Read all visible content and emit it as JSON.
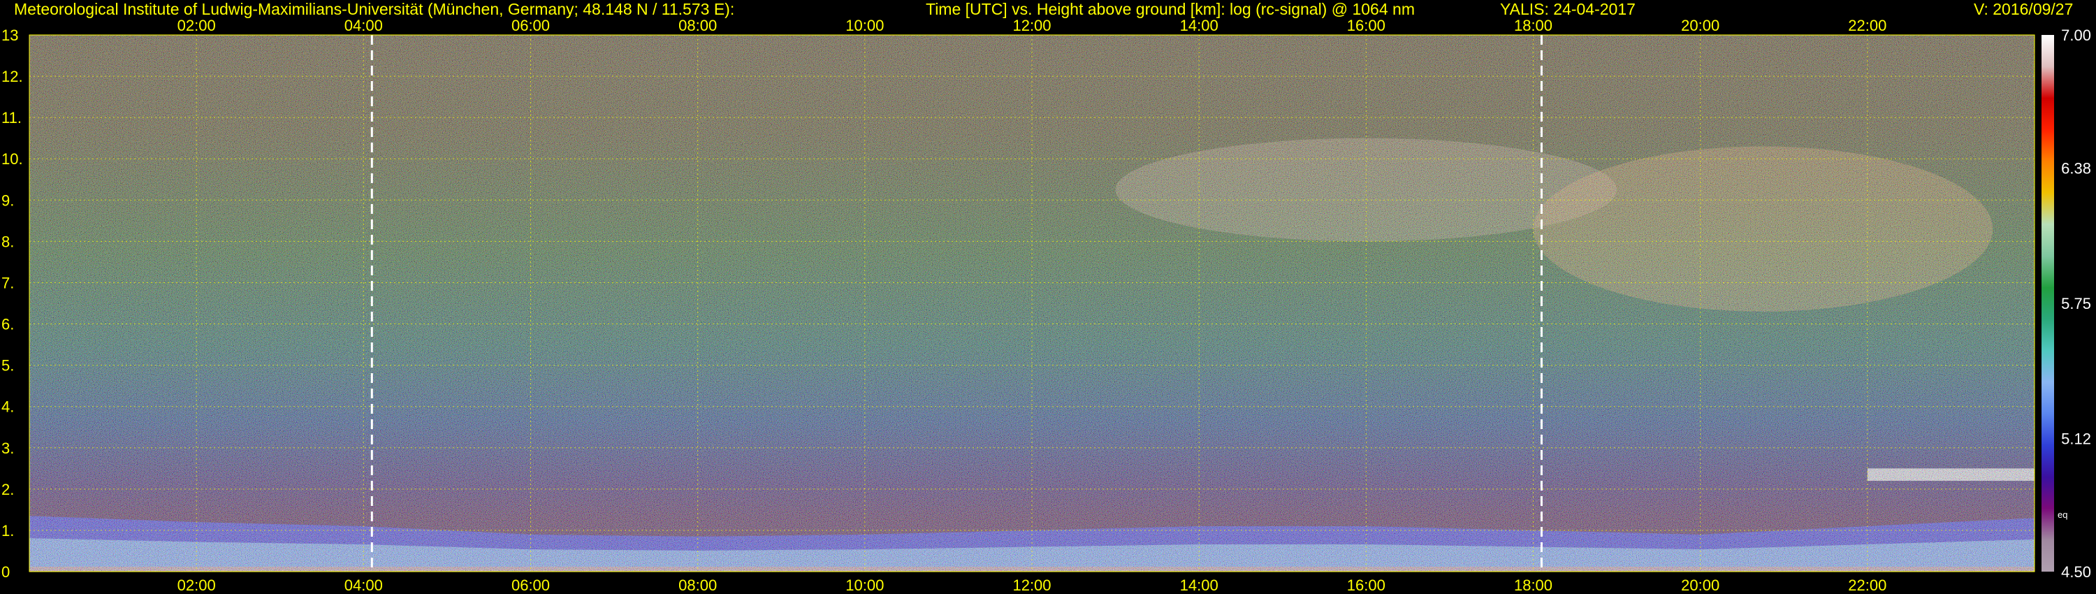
{
  "header": {
    "institute": "Meteorological Institute of Ludwig-Maximilians-Universität (München, Germany; 48.148 N / 11.573 E):",
    "description": "Time [UTC] vs. Height above ground [km]: log (rc-signal) @ 1064 nm",
    "instrument_date": "YALIS: 24-04-2017",
    "version": "V: 2016/09/27"
  },
  "chart_data": {
    "type": "heatmap",
    "xlabel": "Time [UTC]",
    "ylabel": "Height above ground [km]",
    "value_label": "log (rc-signal) @ 1064 nm",
    "x_range_hours": [
      0,
      24
    ],
    "y_range_km": [
      0,
      13
    ],
    "x_ticks": [
      "02:00",
      "04:00",
      "06:00",
      "08:00",
      "10:00",
      "12:00",
      "14:00",
      "16:00",
      "18:00",
      "20:00",
      "22:00"
    ],
    "x_tick_hours": [
      2,
      4,
      6,
      8,
      10,
      12,
      14,
      16,
      18,
      20,
      22
    ],
    "y_ticks": [
      "0",
      "1.",
      "2.",
      "3.",
      "4.",
      "5.",
      "6.",
      "7.",
      "8.",
      "9.",
      "10.",
      "11.",
      "12.",
      "13"
    ],
    "y_tick_values": [
      0,
      1,
      2,
      3,
      4,
      5,
      6,
      7,
      8,
      9,
      10,
      11,
      12,
      13
    ],
    "marker_lines_hours": [
      4.1,
      18.1
    ],
    "grid": true,
    "colorbar": {
      "range": [
        4.5,
        7.0
      ],
      "tick_labels": [
        "7.00",
        "6.38",
        "5.75",
        "5.12",
        "4.50"
      ],
      "tick_values": [
        7.0,
        6.38,
        5.75,
        5.12,
        4.5
      ],
      "note": "eq",
      "colors": [
        "#b0a0b0",
        "#a088a0",
        "#7a0a7a",
        "#3a10a0",
        "#2f3fd8",
        "#5a86ef",
        "#8ab6f3",
        "#50c8c0",
        "#2aa87a",
        "#22a040",
        "#7fc8a0",
        "#b8e0b8",
        "#f0c000",
        "#ff8000",
        "#ff2000",
        "#d00000",
        "#e0c0c0",
        "#ffffff"
      ]
    },
    "features": [
      {
        "name": "aerosol boundary layer",
        "start_hour": 0,
        "end_hour": 24,
        "top_km": [
          1.35,
          1.2,
          1.1,
          0.9,
          0.85,
          0.9,
          1.0,
          1.1,
          1.1,
          1.0,
          0.9,
          1.1,
          1.3
        ]
      },
      {
        "name": "cirrus",
        "start_hour": 13,
        "end_hour": 19,
        "base_km": 8.0,
        "top_km": 10.5
      },
      {
        "name": "mid-level cloud",
        "start_hour": 18,
        "end_hour": 23.5,
        "base_km": 6.3,
        "top_km": 10.3
      },
      {
        "name": "low cloud",
        "start_hour": 22,
        "end_hour": 24,
        "base_km": 2.2,
        "top_km": 2.5
      }
    ]
  }
}
